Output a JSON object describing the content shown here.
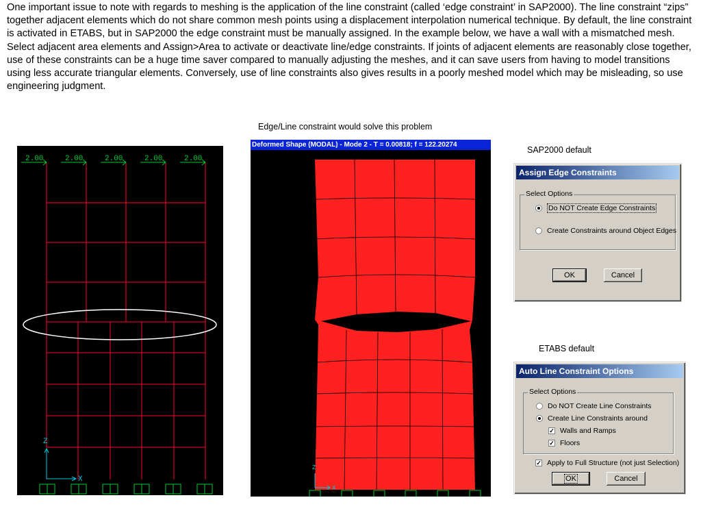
{
  "intro": "One important issue to note with regards to meshing is the application of the line constraint (called ‘edge constraint’ in SAP2000). The line constraint “zips” together adjacent elements which do not share common mesh points using a displacement interpolation numerical technique.  By default, the line constraint is activated in ETABS, but in SAP2000 the edge constraint must be manually assigned. In the example below, we have a wall with a mismatched mesh. Select adjacent area elements and Assign>Area to activate or deactivate line/edge constraints. If joints of adjacent elements are reasonably close together, use of these constraints can be a huge time saver compared to manually adjusting the meshes, and it can save users from having to model transitions using less accurate triangular elements. Conversely, use of line constraints also gives results in a poorly meshed model which may be misleading, so use engineering judgment.",
  "captions": {
    "middle": "Edge/Line constraint would solve this problem",
    "sap": "SAP2000 default",
    "etabs": "ETABS default"
  },
  "left_panel": {
    "load_labels": [
      "2.00",
      "2.00",
      "2.00",
      "2.00",
      "2.00"
    ],
    "axis_z": "Z",
    "axis_x": "X"
  },
  "middle_panel": {
    "title": "Deformed Shape (MODAL) - Mode 2 - T = 0.00818;  f = 122.20274",
    "axis_z": "Z",
    "axis_x": "X"
  },
  "sap_dialog": {
    "title": "Assign Edge Constraints",
    "group_label": "Select Options",
    "option1": "Do NOT Create Edge Constraints",
    "option2": "Create Constraints around Object Edges",
    "ok": "OK",
    "cancel": "Cancel"
  },
  "etabs_dialog": {
    "title": "Auto Line Constraint Options",
    "group_label": "Select Options",
    "option1": "Do NOT Create Line Constraints",
    "option2": "Create Line Constraints around",
    "check1": "Walls and Ramps",
    "check2": "Floors",
    "check3": "Apply to Full Structure (not just Selection)",
    "ok": "OK",
    "cancel": "Cancel"
  },
  "colors": {
    "mesh_line": "#ff0033",
    "fill_red": "#ff2020",
    "green": "#00cc33",
    "axis_cyan": "#00c8d8"
  }
}
